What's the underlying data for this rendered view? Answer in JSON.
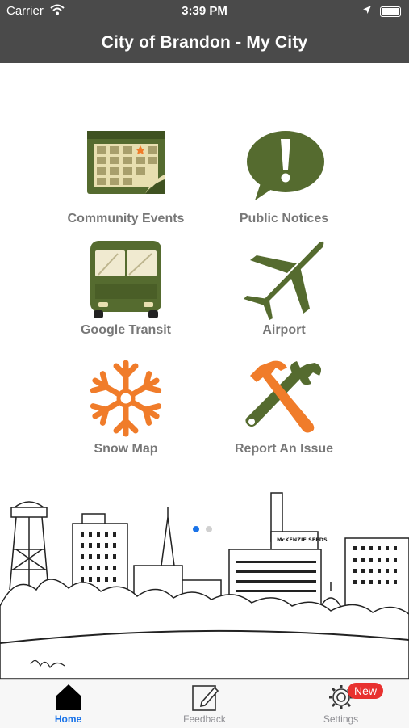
{
  "status_bar": {
    "carrier": "Carrier",
    "time": "3:39 PM"
  },
  "nav": {
    "title": "City of Brandon - My City"
  },
  "tiles": [
    {
      "label": "Community Events",
      "icon": "calendar-icon"
    },
    {
      "label": "Public Notices",
      "icon": "notice-bubble-icon"
    },
    {
      "label": "Google Transit",
      "icon": "bus-icon"
    },
    {
      "label": "Airport",
      "icon": "airplane-icon"
    },
    {
      "label": "Snow Map",
      "icon": "snowflake-icon"
    },
    {
      "label": "Report An Issue",
      "icon": "hammer-wrench-icon"
    }
  ],
  "pager": {
    "count": 2,
    "active_index": 0
  },
  "skyline": {
    "sign_text": "McKENZIE SEEDS"
  },
  "tab_bar": {
    "items": [
      {
        "label": "Home",
        "icon": "home-icon",
        "active": true
      },
      {
        "label": "Feedback",
        "icon": "feedback-icon",
        "active": false
      },
      {
        "label": "Settings",
        "icon": "gear-icon",
        "active": false,
        "badge": "New"
      }
    ]
  },
  "colors": {
    "bar": "#4a4a4a",
    "icon_green": "#556b2f",
    "icon_orange": "#f07c2a",
    "label_gray": "#777777",
    "tab_active": "#1a73e8",
    "badge_red": "#e8312f",
    "dot_active": "#1a73e8",
    "dot_inactive": "#d0d0d0"
  }
}
